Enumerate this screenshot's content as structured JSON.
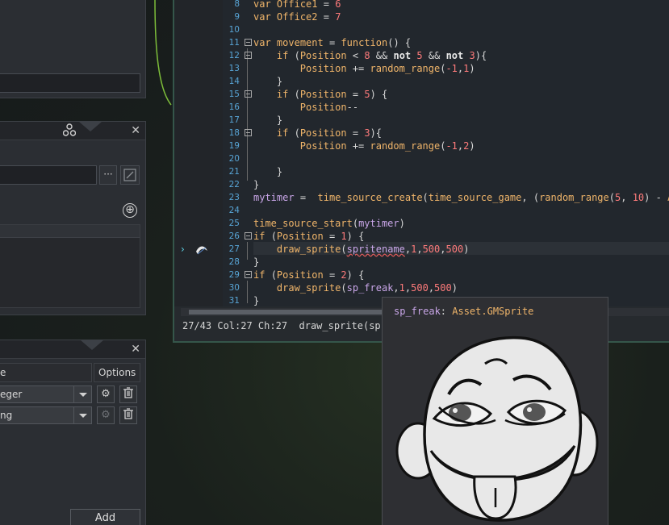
{
  "workspace": {
    "panel_b": {
      "path_value": "",
      "browse_label": "···",
      "add_symbol": "⊕"
    },
    "variables_panel": {
      "col_type": "e",
      "col_options": "Options",
      "rows": [
        {
          "type": "eger"
        },
        {
          "type": "ng"
        }
      ],
      "add_label": "Add"
    }
  },
  "editor": {
    "lines": [
      {
        "n": "8"
      },
      {
        "n": "9"
      },
      {
        "n": "10"
      },
      {
        "n": "11"
      },
      {
        "n": "12"
      },
      {
        "n": "13"
      },
      {
        "n": "14"
      },
      {
        "n": "15"
      },
      {
        "n": "16"
      },
      {
        "n": "17"
      },
      {
        "n": "18"
      },
      {
        "n": "19"
      },
      {
        "n": "20"
      },
      {
        "n": "21"
      },
      {
        "n": "22"
      },
      {
        "n": "23"
      },
      {
        "n": "24"
      },
      {
        "n": "25"
      },
      {
        "n": "26"
      },
      {
        "n": "27"
      },
      {
        "n": "28"
      },
      {
        "n": "29"
      },
      {
        "n": "30"
      },
      {
        "n": "31"
      }
    ],
    "status_position": "27/43 Col:27 Ch:27",
    "status_signature": "draw_sprite(sprite,subi"
  },
  "tooltip": {
    "name": "sp_freak",
    "separator": ": ",
    "type": "Asset.GMSprite"
  },
  "colors": {
    "keyword": "#f0b56a",
    "number": "#ff7b7b",
    "variable": "#c9a6e8",
    "line_number": "#58a5d6",
    "editor_border": "#35564a"
  }
}
